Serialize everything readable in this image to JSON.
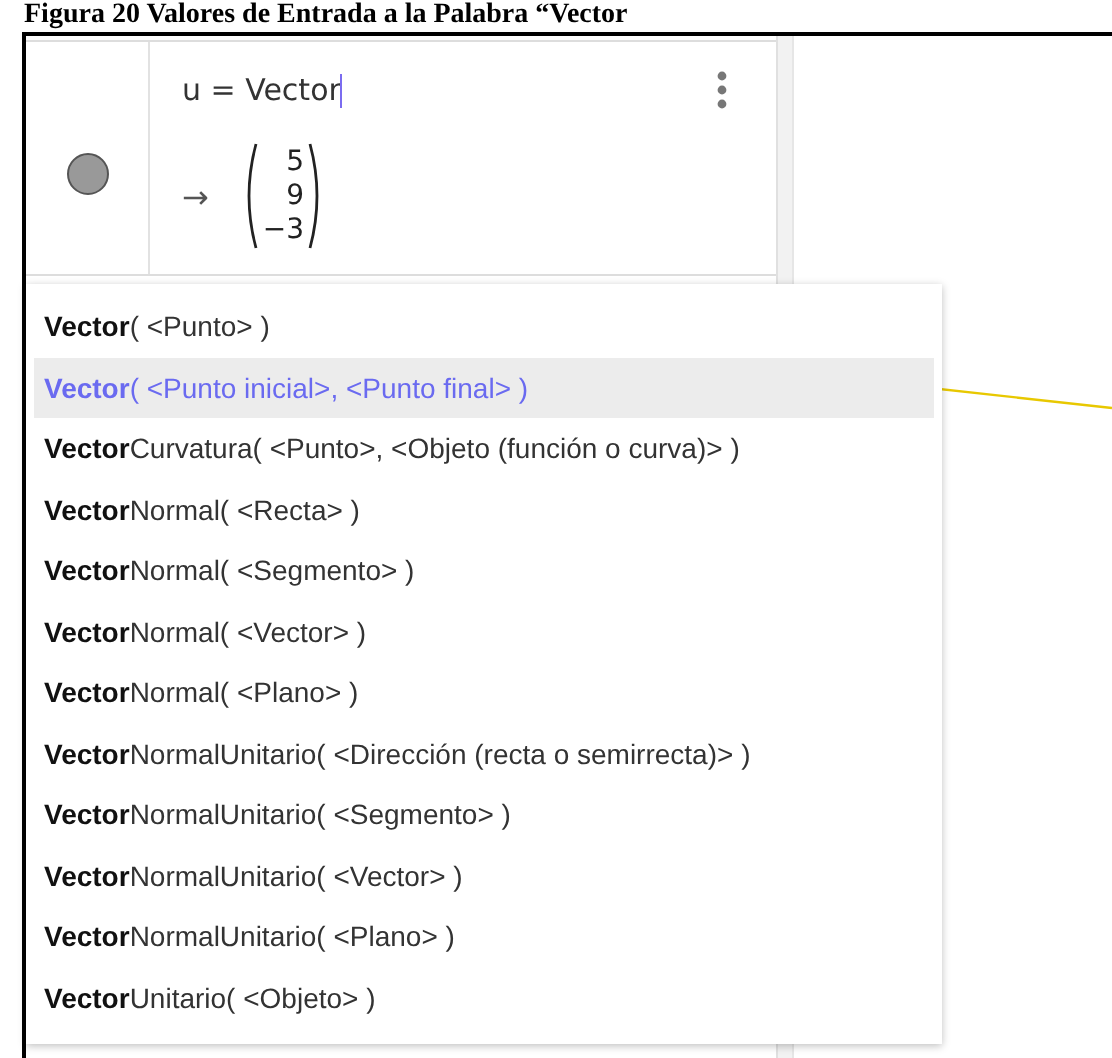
{
  "caption": "Figura 20 Valores de Entrada a la Palabra “Vector",
  "input": {
    "value": "u = Vector"
  },
  "output": {
    "arrow": "→",
    "components": [
      "5",
      "9",
      "−3"
    ]
  },
  "suggestions": [
    {
      "text": "**Vector**( <Punto> )",
      "selected": false
    },
    {
      "text": "**Vector**( <Punto inicial>, <Punto final> )",
      "selected": true
    },
    {
      "text": "**Vector**Curvatura( <Punto>, <Objeto (función o curva)> )",
      "selected": false
    },
    {
      "text": "**Vector**Normal( <Recta> )",
      "selected": false
    },
    {
      "text": "**Vector**Normal( <Segmento> )",
      "selected": false
    },
    {
      "text": "**Vector**Normal( <Vector> )",
      "selected": false
    },
    {
      "text": "**Vector**Normal( <Plano> )",
      "selected": false
    },
    {
      "text": "**Vector**NormalUnitario( <Dirección (recta o semirrecta)> )",
      "selected": false
    },
    {
      "text": "**Vector**NormalUnitario( <Segmento> )",
      "selected": false
    },
    {
      "text": "**Vector**NormalUnitario( <Vector> )",
      "selected": false
    },
    {
      "text": "**Vector**NormalUnitario( <Plano> )",
      "selected": false
    },
    {
      "text": "**Vector**Unitario( <Objeto> )",
      "selected": false
    }
  ]
}
